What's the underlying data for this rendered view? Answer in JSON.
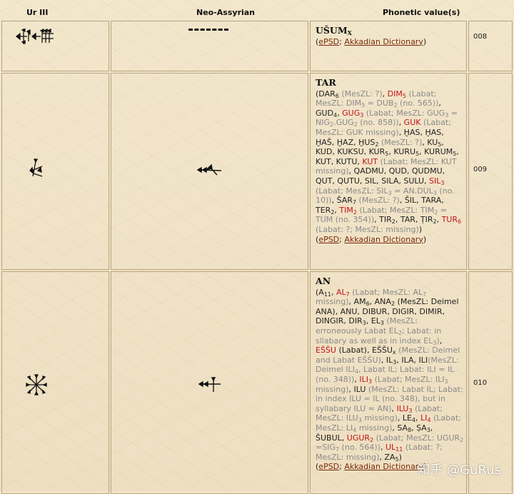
{
  "headers": {
    "ur3": "Ur III",
    "neo": "Neo-Assyrian",
    "phon": "Phonetic value(s)"
  },
  "rows": [
    {
      "num": "008",
      "heading": "UŠUM",
      "heading_sub": "X",
      "links": {
        "a": "ePSD",
        "b": "Akkadian Dictionary"
      }
    },
    {
      "num": "009",
      "heading": "TAR",
      "links": {
        "a": "ePSD",
        "b": "Akkadian Dictionary"
      }
    },
    {
      "num": "010",
      "heading": "AN",
      "links": {
        "a": "ePSD",
        "b": "Akkadian Dictionary"
      }
    }
  ],
  "watermark": "知乎 @GuRus",
  "icons": [
    "cuneiform-ushum-sign",
    "cuneiform-tar-sign",
    "cuneiform-an-sign"
  ]
}
